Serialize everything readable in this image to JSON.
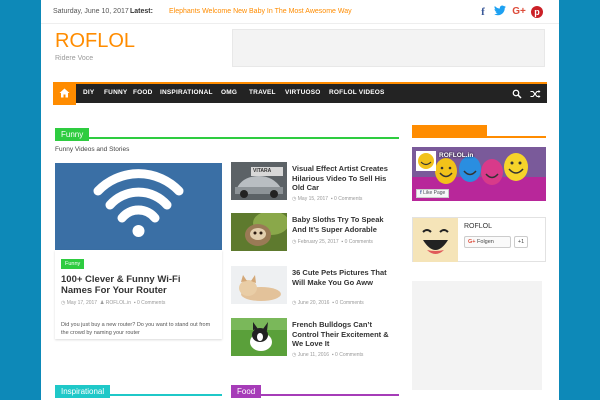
{
  "topbar": {
    "date": "Saturday, June 10, 2017",
    "latest_label": "Latest:",
    "latest_headline": "Elephants Welcome New Baby In The Most Awesome Way",
    "social": {
      "facebook": "f",
      "twitter": "t",
      "googleplus": "G+",
      "pinterest": "p"
    }
  },
  "site": {
    "title": "ROFLOL",
    "description": "Ridere Voce"
  },
  "nav": {
    "items": [
      "DIY",
      "FUNNY",
      "FOOD",
      "INSPIRATIONAL",
      "OMG",
      "TRAVEL",
      "VIRTUOSO",
      "ROFLOL VIDEOS"
    ],
    "icons": [
      "home-icon",
      "search-icon",
      "shuffle-icon"
    ]
  },
  "funny_section": {
    "title": "Funny",
    "subtitle": "Funny Videos and Stories",
    "color": "#2ecc40",
    "featured": {
      "category": "Funny",
      "title": "100+ Clever & Funny Wi-Fi Names For Your Router",
      "date": "May 17, 2017",
      "author": "ROFLOL.in",
      "comments": "0 Comments",
      "excerpt": "Did you just buy a new router? Do you want to stand out from the crowd by naming your router"
    },
    "posts": [
      {
        "title": "Visual Effect Artist Creates Hilarious Video To Sell His Old Car",
        "date": "May 15, 2017",
        "comments": "0 Comments",
        "image_text": "VITARA"
      },
      {
        "title": "Baby Sloths Try To Speak And It’s Super Adorable",
        "date": "February 25, 2017",
        "comments": "0 Comments"
      },
      {
        "title": "36 Cute Pets Pictures That Will Make You Go Aww",
        "date": "June 20, 2016",
        "comments": "0 Comments"
      },
      {
        "title": "French Bulldogs Can’t Control Their Excitement & We Love It",
        "date": "June 11, 2016",
        "comments": "0 Comments"
      }
    ]
  },
  "bottom_sections": [
    {
      "title": "Inspirational",
      "color": "#1fc8c8"
    },
    {
      "title": "Food",
      "color": "#a63cb8"
    }
  ],
  "sidebar": {
    "facebook_widget": {
      "page_name": "ROFLOL.in",
      "like_label": "Like Page"
    },
    "social_card": {
      "name": "ROFLOL",
      "follow_label": "Folgen",
      "plus_count": "+1"
    }
  },
  "colors": {
    "accent": "#ff8c00",
    "background": "#0d89b8",
    "navbar": "#232323",
    "funny": "#2ecc40",
    "inspirational": "#1fc8c8",
    "food": "#a63cb8"
  }
}
